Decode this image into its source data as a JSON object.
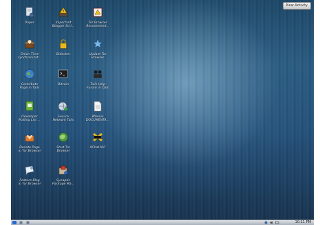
{
  "top_button": {
    "label": "New Activity"
  },
  "desktop_icons": [
    {
      "label": "Paper",
      "icon": "document-gear-icon"
    },
    {
      "label": "Important\nBlogger Scri...",
      "icon": "warning-package-icon"
    },
    {
      "label": "Tor Browser\nRecommend...",
      "icon": "warning-browser-icon"
    },
    {
      "label": "Onion Time\nsynchronizat...",
      "icon": "clock-package-icon"
    },
    {
      "label": "Bitlocker",
      "icon": "lock-icon"
    },
    {
      "label": "Update Tor\nBrowser",
      "icon": "update-star-icon"
    },
    {
      "label": "Contribute\nPage in Tails",
      "icon": "globe-icon"
    },
    {
      "label": "Bitcoin",
      "icon": "terminal-icon"
    },
    {
      "label": "Tails Help\nForum in Tails",
      "icon": "people-icon"
    },
    {
      "label": "Developer\nMailing List ...",
      "icon": "mailing-list-icon"
    },
    {
      "label": "Secure\nNetwork Tails",
      "icon": "network-globe-icon"
    },
    {
      "label": "Whonix\nDOCUMENTA...",
      "icon": "text-document-icon"
    },
    {
      "label": "Donate Page\nin Tor Browser",
      "icon": "donate-heart-icon"
    },
    {
      "label": "Start Tor\nBrowser",
      "icon": "tor-globe-icon"
    },
    {
      "label": "XChat IRC",
      "icon": "irc-chat-icon"
    },
    {
      "label": "Feature Blog\nin Tor Browser",
      "icon": "feature-bubble-icon"
    },
    {
      "label": "Synaptic\nPackage Ma...",
      "icon": "synaptic-package-icon"
    }
  ],
  "taskbar": {
    "clock": "10:11 PM",
    "items": [
      "kde-start-icon",
      "network-icon",
      "volume-icon",
      "battery-icon"
    ]
  }
}
